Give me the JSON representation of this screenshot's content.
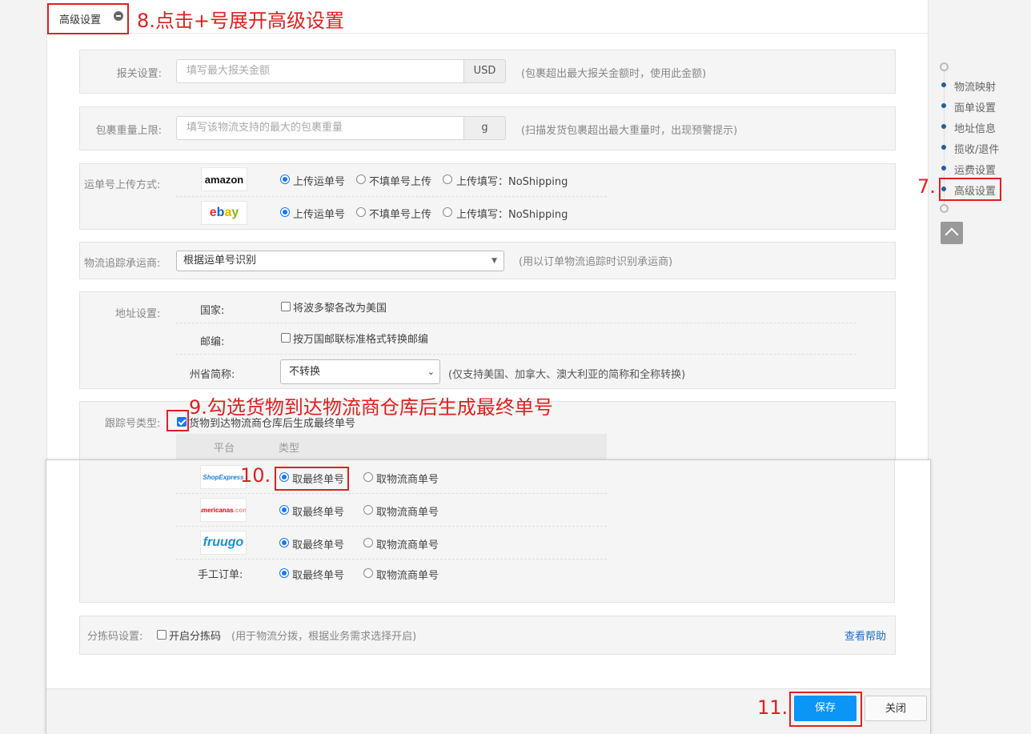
{
  "header": {
    "title": "高级设置"
  },
  "annotations": {
    "a7": "7.",
    "a8": "8.点击+号展开高级设置",
    "a9": "9.勾选货物到达物流商仓库后生成最终单号",
    "a10": "10.",
    "a11": "11."
  },
  "customs": {
    "label": "报关设置:",
    "placeholder": "填写最大报关金额",
    "unit": "USD",
    "hint": "(包裹超出最大报关金额时，使用此金额)"
  },
  "weight": {
    "label": "包裹重量上限:",
    "placeholder": "填写该物流支持的最大的包裹重量",
    "unit": "g",
    "hint": "(扫描发货包裹超出最大重量时，出现预警提示)"
  },
  "upload": {
    "label": "运单号上传方式:",
    "rows": [
      {
        "logo": "amazon",
        "opt1": "上传运单号",
        "opt2": "不填单号上传",
        "opt3": "上传填写：NoShipping"
      },
      {
        "logo": "ebay",
        "opt1": "上传运单号",
        "opt2": "不填单号上传",
        "opt3": "上传填写：NoShipping"
      }
    ]
  },
  "carrier": {
    "label": "物流追踪承运商:",
    "value": "根据运单号识别",
    "hint": "(用以订单物流追踪时识别承运商)"
  },
  "address": {
    "label": "地址设置:",
    "country_label": "国家:",
    "country_option": "将波多黎各改为美国",
    "zip_label": "邮编:",
    "zip_option": "按万国邮联标准格式转换邮编",
    "state_label": "州省简称:",
    "state_value": "不转换",
    "state_hint": "(仅支持美国、加拿大、澳大利亚的简称和全称转换)"
  },
  "tracking": {
    "label": "跟踪号类型:",
    "check_label": "货物到达物流商仓库后生成最终单号",
    "col_platform": "平台",
    "col_type": "类型",
    "rows": [
      {
        "logo": "ShopExpress",
        "opt1": "取最终单号",
        "opt2": "取物流商单号"
      },
      {
        "logo": "americanas",
        "opt1": "取最终单号",
        "opt2": "取物流商单号"
      },
      {
        "logo": "fruugo",
        "opt1": "取最终单号",
        "opt2": "取物流商单号"
      },
      {
        "logo": "手工订单:",
        "opt1": "取最终单号",
        "opt2": "取物流商单号"
      }
    ]
  },
  "sorting": {
    "label": "分拣码设置:",
    "option": "开启分拣码",
    "hint": "(用于物流分拨，根据业务需求选择开启)",
    "help": "查看帮助"
  },
  "nav": {
    "items": [
      "物流映射",
      "面单设置",
      "地址信息",
      "揽收/退件",
      "运费设置",
      "高级设置"
    ]
  },
  "footer": {
    "save": "保存",
    "close": "关闭"
  },
  "colors": {
    "accent": "#1677ff",
    "annotation": "#e02020",
    "nav_dot": "#1c5fa8"
  }
}
